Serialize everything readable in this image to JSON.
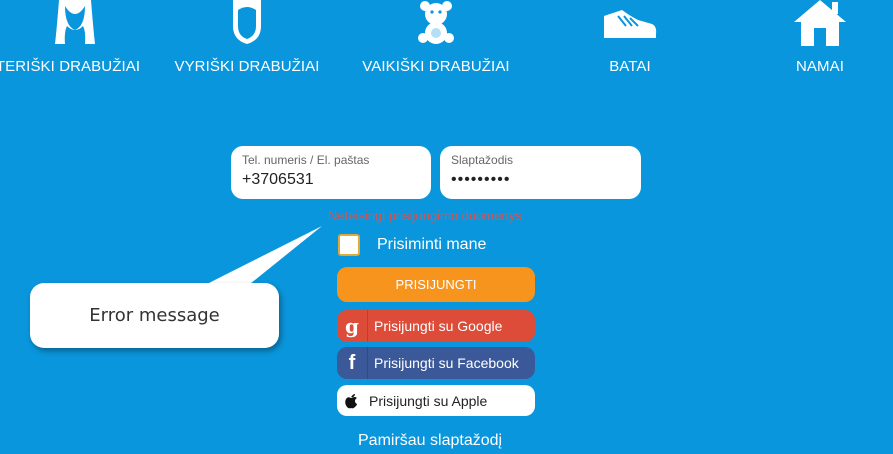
{
  "nav": {
    "items": [
      {
        "label": "TERIŠKI DRABUŽIAI",
        "icon": "woman-icon"
      },
      {
        "label": "VYRIŠKI DRABUŽIAI",
        "icon": "man-icon"
      },
      {
        "label": "VAIKIŠKI DRABUŽIAI",
        "icon": "teddy-bear-icon"
      },
      {
        "label": "BATAI",
        "icon": "shoe-icon"
      },
      {
        "label": "NAMAI",
        "icon": "house-icon"
      }
    ]
  },
  "login": {
    "phone_label": "Tel. numeris / El. paštas",
    "phone_value": "+3706531",
    "password_label": "Slaptažodis",
    "password_value": "•••••••••",
    "error": "Neteisingi prisijungimo duomenys",
    "remember_label": "Prisiminti mane",
    "remember_checked": false,
    "login_button": "PRISIJUNGTI",
    "google_button": "Prisijungti su Google",
    "facebook_button": "Prisijungti su Facebook",
    "apple_button": "Prisijungti su Apple",
    "forgot_link": "Pamiršau slaptažodį"
  },
  "callout": {
    "text": "Error message"
  },
  "colors": {
    "background": "#0a96dc",
    "login_button": "#f7941d",
    "google": "#dd4b39",
    "facebook": "#3b5998",
    "error": "#d9534f"
  }
}
